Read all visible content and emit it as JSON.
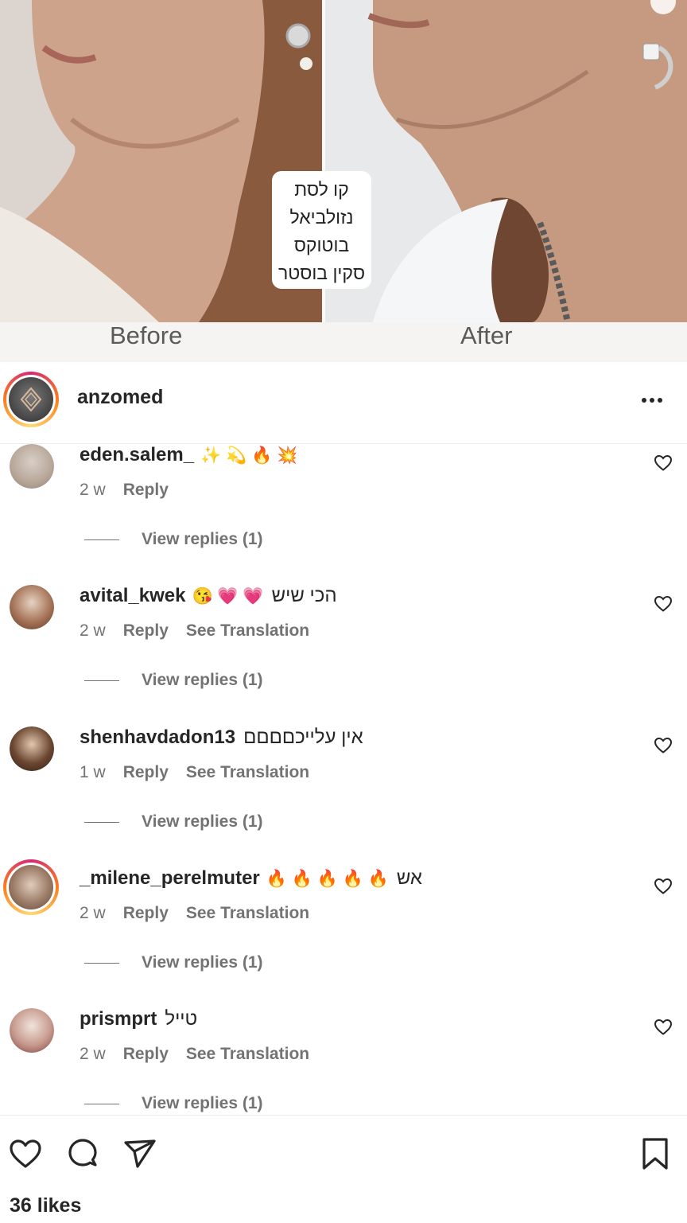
{
  "post": {
    "before_label": "Before",
    "after_label": "After",
    "treatment_lines": [
      "קו לסת",
      "נזולביאל",
      "בוטוקס",
      "סקין בוסטר"
    ]
  },
  "header": {
    "username": "anzomed",
    "more_icon": "more-horizontal-icon"
  },
  "comments": [
    {
      "username": "eden.salem_",
      "emojis": "✨ 💫 🔥 💥",
      "text": "",
      "time": "2 w",
      "reply_label": "Reply",
      "translation_label": "",
      "view_replies": "View replies (1)"
    },
    {
      "username": "avital_kwek",
      "emojis": "😘 💗 💗",
      "text": "הכי שיש",
      "time": "2 w",
      "reply_label": "Reply",
      "translation_label": "See Translation",
      "view_replies": "View replies (1)"
    },
    {
      "username": "shenhavdadon13",
      "emojis": "",
      "text": "אין עלייכםםםם",
      "time": "1 w",
      "reply_label": "Reply",
      "translation_label": "See Translation",
      "view_replies": "View replies (1)"
    },
    {
      "username": "_milene_perelmuter",
      "emojis": "🔥 🔥 🔥 🔥 🔥",
      "text": "אש",
      "time": "2 w",
      "reply_label": "Reply",
      "translation_label": "See Translation",
      "view_replies": "View replies (1)"
    },
    {
      "username": "prismprt",
      "emojis": "",
      "text": "טייל",
      "time": "2 w",
      "reply_label": "Reply",
      "translation_label": "See Translation",
      "view_replies": "View replies (1)"
    }
  ],
  "actions": {
    "like_icon": "heart-outline-icon",
    "comment_icon": "comment-bubble-icon",
    "share_icon": "paper-plane-icon",
    "save_icon": "bookmark-icon"
  },
  "likes_text": "36 likes",
  "colors": {
    "text_primary": "#262626",
    "text_secondary": "#737373",
    "story_ring": [
      "#d62976",
      "#fa7e1e",
      "#feda75"
    ]
  }
}
